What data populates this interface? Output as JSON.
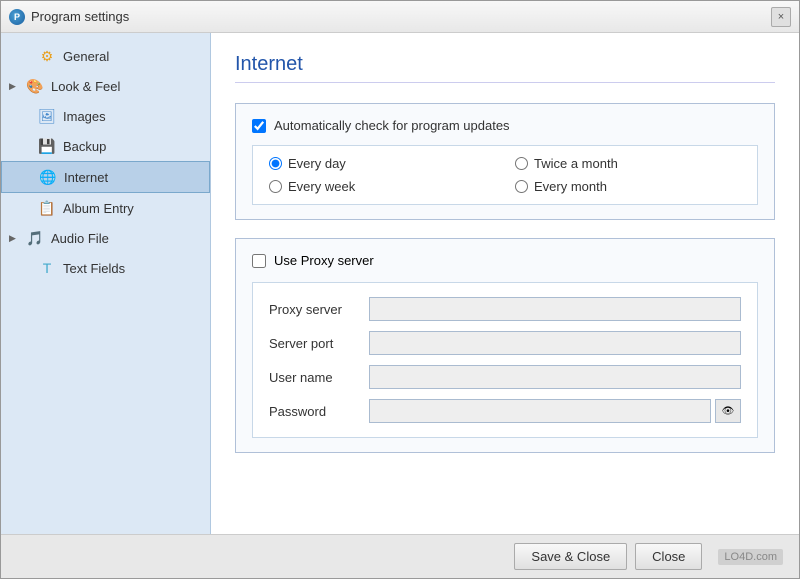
{
  "window": {
    "title": "Program settings",
    "close_label": "×"
  },
  "sidebar": {
    "items": [
      {
        "id": "general",
        "label": "General",
        "icon": "⚙",
        "icon_class": "icon-general",
        "has_arrow": false,
        "active": false
      },
      {
        "id": "look-feel",
        "label": "Look & Feel",
        "icon": "🎨",
        "icon_class": "icon-look",
        "has_arrow": true,
        "active": false
      },
      {
        "id": "images",
        "label": "Images",
        "icon": "🖼",
        "icon_class": "icon-images",
        "has_arrow": false,
        "active": false
      },
      {
        "id": "backup",
        "label": "Backup",
        "icon": "💾",
        "icon_class": "icon-backup",
        "has_arrow": false,
        "active": false
      },
      {
        "id": "internet",
        "label": "Internet",
        "icon": "🌐",
        "icon_class": "icon-internet",
        "has_arrow": false,
        "active": true
      },
      {
        "id": "album-entry",
        "label": "Album Entry",
        "icon": "📋",
        "icon_class": "icon-album",
        "has_arrow": false,
        "active": false
      },
      {
        "id": "audio-file",
        "label": "Audio File",
        "icon": "🎵",
        "icon_class": "icon-audio",
        "has_arrow": true,
        "active": false
      },
      {
        "id": "text-fields",
        "label": "Text Fields",
        "icon": "T",
        "icon_class": "icon-textfields",
        "has_arrow": false,
        "active": false
      }
    ]
  },
  "content": {
    "title": "Internet",
    "auto_update": {
      "checkbox_label": "Automatically check for program updates",
      "checked": true,
      "options": [
        {
          "id": "every-day",
          "label": "Every day",
          "checked": true
        },
        {
          "id": "twice-month",
          "label": "Twice a month",
          "checked": false
        },
        {
          "id": "every-week",
          "label": "Every week",
          "checked": false
        },
        {
          "id": "every-month",
          "label": "Every month",
          "checked": false
        }
      ]
    },
    "proxy": {
      "checkbox_label": "Use Proxy server",
      "checked": false,
      "fields": [
        {
          "id": "proxy-server",
          "label": "Proxy server",
          "value": "",
          "type": "text"
        },
        {
          "id": "server-port",
          "label": "Server port",
          "value": "",
          "type": "text"
        },
        {
          "id": "user-name",
          "label": "User name",
          "value": "",
          "type": "text"
        },
        {
          "id": "password",
          "label": "Password",
          "value": "",
          "type": "password"
        }
      ]
    }
  },
  "footer": {
    "save_close_label": "Save & Close",
    "close_label": "Close",
    "logo_label": "LO4D.com"
  }
}
